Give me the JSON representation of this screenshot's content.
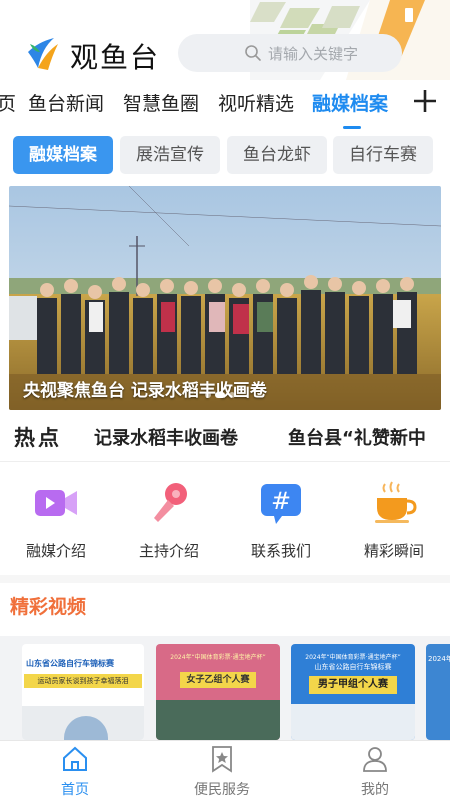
{
  "header": {
    "app_title": "观鱼台",
    "search_placeholder": "请输入关键字"
  },
  "nav": {
    "items": [
      "页",
      "鱼台新闻",
      "智慧鱼圈",
      "视听精选",
      "融媒档案"
    ],
    "active_index": 4
  },
  "subtabs": {
    "items": [
      "融媒档案",
      "展浩宣传",
      "鱼台龙虾",
      "自行车赛"
    ],
    "active_index": 0
  },
  "banner": {
    "caption": "央视聚焦鱼台 记录水稻丰收画卷",
    "slides": 3,
    "current": 1
  },
  "hot": {
    "label": "热点",
    "items": [
      "记录水稻丰收画卷",
      "鱼台县“礼赞新中"
    ]
  },
  "quick_links": [
    {
      "label": "融媒介绍",
      "icon": "video-camera-icon"
    },
    {
      "label": "主持介绍",
      "icon": "microphone-icon"
    },
    {
      "label": "联系我们",
      "icon": "hashtag-chat-icon"
    },
    {
      "label": "精彩瞬间",
      "icon": "coffee-cup-icon"
    }
  ],
  "section": {
    "title": "精彩视频",
    "thumbs": [
      {
        "top_text": "山东省公路自行车锦标赛",
        "sub_text": "运动员家长谈到孩子幸福落泪",
        "banner": ""
      },
      {
        "top_text": "2024年“中国体育彩票·通宝地产杯”",
        "sub_text": "",
        "banner": "女子乙组个人赛"
      },
      {
        "top_text": "2024年“中国体育彩票·通宝地产杯”",
        "sub_text": "山东省公路自行车锦标赛",
        "banner": "男子甲组个人赛"
      },
      {
        "top_text": "2024年",
        "sub_text": "",
        "banner": ""
      }
    ]
  },
  "tabbar": {
    "items": [
      "首页",
      "便民服务",
      "我的"
    ],
    "active_index": 0
  },
  "colors": {
    "accent": "#1e8bf0",
    "section_title": "#f0703b"
  }
}
